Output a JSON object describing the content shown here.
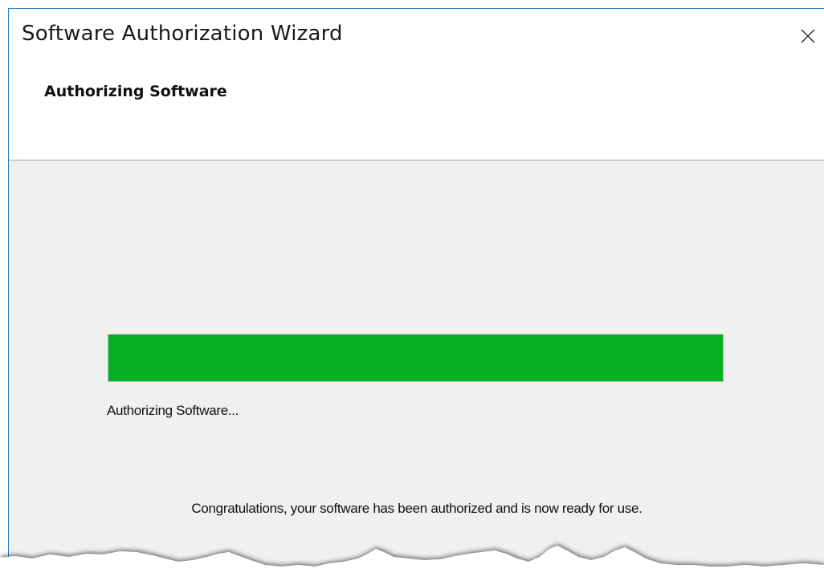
{
  "window": {
    "title": "Software Authorization Wizard",
    "close_icon": "close-icon"
  },
  "header": {
    "heading": "Authorizing Software"
  },
  "progress": {
    "percent": 100,
    "fill_color": "#06b025",
    "status_text": "Authorizing Software..."
  },
  "message": {
    "success_text": "Congratulations, your software has been authorized and is now ready for use."
  },
  "colors": {
    "window_border": "#1e79c9",
    "content_background": "#f0f0f0",
    "progress_green": "#06b025"
  }
}
